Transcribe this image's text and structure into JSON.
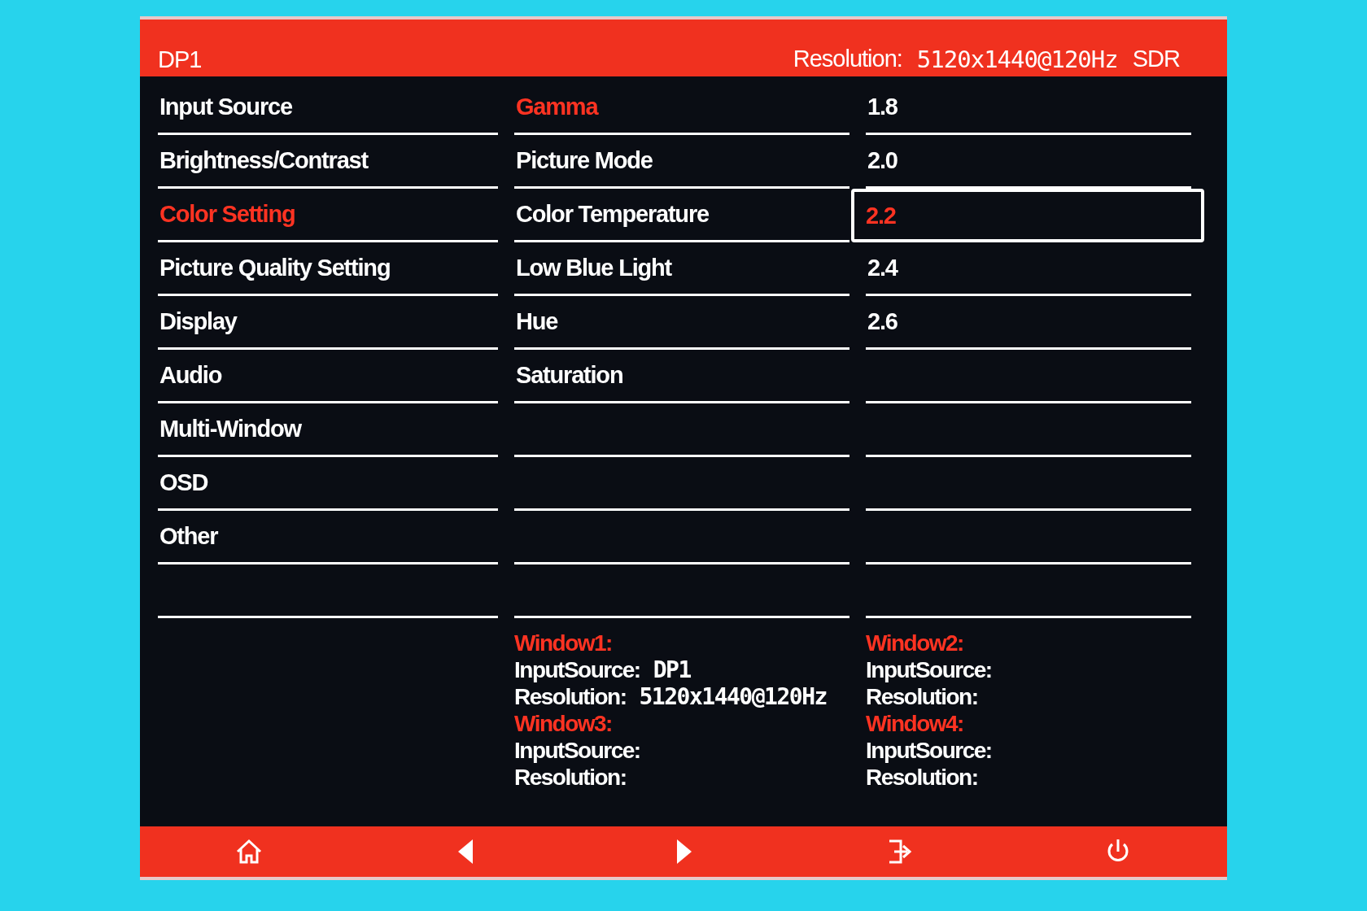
{
  "header": {
    "input": "DP1",
    "resolution_label": "Resolution:",
    "resolution": "5120x1440@120Hz",
    "dynamic_range": "SDR"
  },
  "menu": [
    {
      "label": "Input Source",
      "selected": false
    },
    {
      "label": "Brightness/Contrast",
      "selected": false
    },
    {
      "label": "Color Setting",
      "selected": true
    },
    {
      "label": "Picture Quality Setting",
      "selected": false
    },
    {
      "label": "Display",
      "selected": false
    },
    {
      "label": "Audio",
      "selected": false
    },
    {
      "label": "Multi-Window",
      "selected": false
    },
    {
      "label": "OSD",
      "selected": false
    },
    {
      "label": "Other",
      "selected": false
    }
  ],
  "submenu": [
    {
      "label": "Gamma",
      "selected": true
    },
    {
      "label": "Picture Mode",
      "selected": false
    },
    {
      "label": "Color Temperature",
      "selected": false
    },
    {
      "label": "Low Blue Light",
      "selected": false
    },
    {
      "label": "Hue",
      "selected": false
    },
    {
      "label": "Saturation",
      "selected": false
    }
  ],
  "options": [
    {
      "label": "1.8",
      "selected": false
    },
    {
      "label": "2.0",
      "selected": false
    },
    {
      "label": "2.2",
      "selected": true
    },
    {
      "label": "2.4",
      "selected": false
    },
    {
      "label": "2.6",
      "selected": false
    }
  ],
  "windows": [
    {
      "title": "Window1:",
      "input_label": "InputSource:",
      "input": "DP1",
      "resolution_label": "Resolution:",
      "resolution": "5120x1440@120Hz"
    },
    {
      "title": "Window2:",
      "input_label": "InputSource:",
      "resolution_label": "Resolution:"
    },
    {
      "title": "Window3:",
      "input_label": "InputSource:",
      "resolution_label": "Resolution:"
    },
    {
      "title": "Window4:",
      "input_label": "InputSource:",
      "resolution_label": "Resolution:"
    }
  ]
}
